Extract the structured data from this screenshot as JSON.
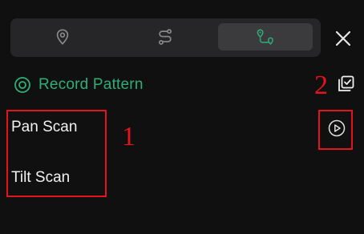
{
  "tabs": [
    {
      "icon": "location-pin-icon",
      "active": false
    },
    {
      "icon": "route-icon",
      "active": false
    },
    {
      "icon": "pattern-route-icon",
      "active": true
    }
  ],
  "record": {
    "label": "Record Pattern",
    "color": "#2fae78"
  },
  "patterns": [
    {
      "label": "Pan Scan"
    },
    {
      "label": "Tilt Scan"
    }
  ],
  "annotations": {
    "one": "1",
    "two": "2",
    "color": "#e3141c"
  }
}
